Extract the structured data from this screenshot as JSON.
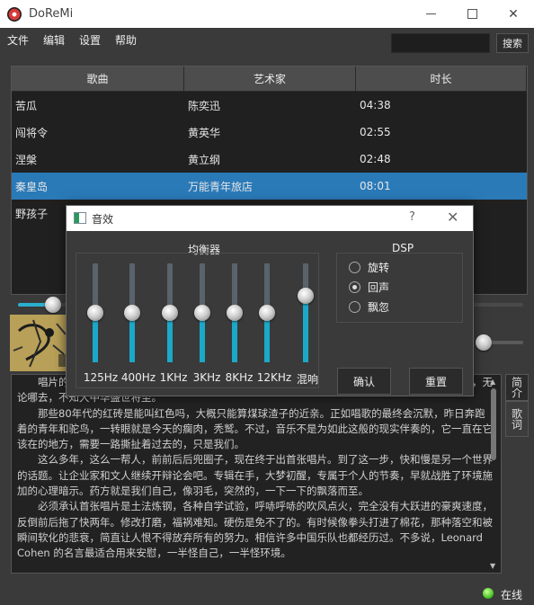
{
  "window": {
    "title": "DoReMi"
  },
  "menu": [
    "文件",
    "编辑",
    "设置",
    "帮助"
  ],
  "search": {
    "value": "",
    "button_label": "搜索"
  },
  "table": {
    "headers": [
      "歌曲",
      "艺术家",
      "时长"
    ],
    "rows": [
      [
        "苦瓜",
        "陈奕迅",
        "04:38"
      ],
      [
        "闯将令",
        "黄英华",
        "02:55"
      ],
      [
        "涅槃",
        "黄立纲",
        "02:48"
      ],
      [
        "秦皇岛",
        "万能青年旅店",
        "08:01"
      ],
      [
        "野孩子",
        "",
        ""
      ]
    ],
    "selected_row": 3
  },
  "player": {
    "progress": 0.07,
    "volume": 0.15
  },
  "side_tabs": [
    "简介",
    "歌词"
  ],
  "intro_text": [
    "唱片的封面……黄，周围住的多数是老人。东欢在这一片半老半新的旧小里……扯皮，吃喝拉撒，无论哪去，不知大中华盛世将至。",
    "那些80年代的红砖是能叫红色吗，大概只能算煤球渣子的近亲。正如唱歌的最终会沉默，昨日奔跑着的青年和驼鸟，一转眼就是今天的瘸肉，秃鹫。不过，音乐不是为如此这般的现实伴奏的，它一直在它该在的地方，需要一路撕扯着过去的，只是我们。",
    "这么多年，这么一帮人，前前后后兜圈子，现在终于出首张唱片。到了这一步，快和慢是另一个世界的话题。让企业家和文人继续开辩论会吧。专辑在手，大梦初醒，专属于个人的节奏，早就战胜了环境施加的心理暗示。药方就是我们自己，像羽毛，突然的，一下一下的飘落而至。",
    "必须承认首张唱片是土法炼钢，各种自学试验，呼哧呼哧的吹风点火，完全没有大跃进的豪爽速度，反倒前后拖了快两年。修改打磨，福祸难知。硬伤是免不了的。有时候像拳头打进了棉花，那种落空和被瞬间软化的悲衰，简直让人恨不得放弃所有的努力。相信许多中国乐队也都经历过。不多说，Leonard Cohen 的名言最适合用来安慰，一半怪自己，一半怪环境。"
  ],
  "status": {
    "text": "在线",
    "color": "#4fc826"
  },
  "accent_color": "#2ab0ce",
  "selection_color": "#2a7ab8",
  "effects_dialog": {
    "title": "音效",
    "help_label": "?",
    "eq_label": "均衡器",
    "bands": [
      {
        "label": "125Hz",
        "level": 0.5
      },
      {
        "label": "400Hz",
        "level": 0.5
      },
      {
        "label": "1KHz",
        "level": 0.5
      },
      {
        "label": "3KHz",
        "level": 0.5
      },
      {
        "label": "8KHz",
        "level": 0.5
      },
      {
        "label": "12KHz",
        "level": 0.5
      },
      {
        "label": "混响",
        "level": 0.67
      }
    ],
    "dsp_label": "DSP",
    "dsp_options": [
      {
        "label": "旋转",
        "selected": false
      },
      {
        "label": "回声",
        "selected": true
      },
      {
        "label": "飘忽",
        "selected": false
      }
    ],
    "ok_label": "确认",
    "reset_label": "重置"
  }
}
